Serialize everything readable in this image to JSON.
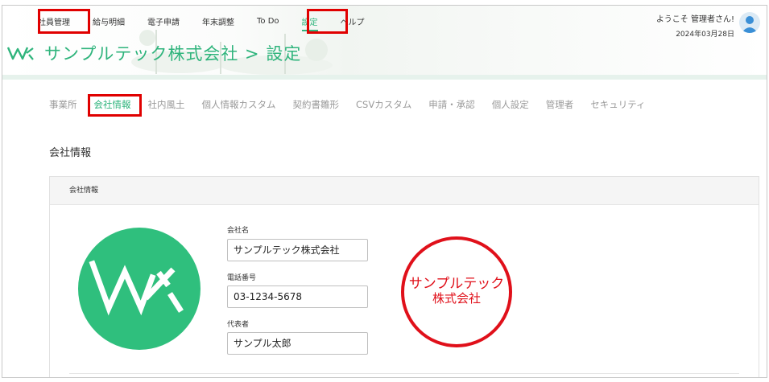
{
  "topnav": {
    "items": [
      {
        "label": "社員管理",
        "active": false
      },
      {
        "label": "給与明細",
        "active": false
      },
      {
        "label": "電子申請",
        "active": false
      },
      {
        "label": "年末調整",
        "active": false
      },
      {
        "label": "To Do",
        "active": false
      },
      {
        "label": "設定",
        "active": true
      },
      {
        "label": "ヘルプ",
        "active": false
      }
    ]
  },
  "header": {
    "brand_title": "サンプルテック株式会社 > 設定",
    "welcome": "ようこそ 管理者さん!",
    "date": "2024年03月28日"
  },
  "subnav": {
    "tabs": [
      {
        "label": "事業所",
        "active": false
      },
      {
        "label": "会社情報",
        "active": true
      },
      {
        "label": "社内風土",
        "active": false
      },
      {
        "label": "個人情報カスタム",
        "active": false
      },
      {
        "label": "契約書雛形",
        "active": false
      },
      {
        "label": "CSVカスタム",
        "active": false
      },
      {
        "label": "申請・承認",
        "active": false
      },
      {
        "label": "個人設定",
        "active": false
      },
      {
        "label": "管理者",
        "active": false
      },
      {
        "label": "セキュリティ",
        "active": false
      }
    ]
  },
  "page": {
    "section_title": "会社情報",
    "panel_title": "会社情報"
  },
  "form": {
    "company_name_label": "会社名",
    "company_name_value": "サンプルテック株式会社",
    "phone_label": "電話番号",
    "phone_value": "03-1234-5678",
    "representative_label": "代表者",
    "representative_value": "サンプル太郎"
  },
  "stamp": {
    "line1": "サンプルテック",
    "line2": "株式会社"
  },
  "colors": {
    "accent": "#2fb47c",
    "logo_green": "#2fbf7d",
    "highlight_red": "#e00000",
    "stamp_red": "#e0101a"
  },
  "icons": {
    "brand": "brand-logo-icon",
    "avatar": "user-avatar-icon"
  }
}
